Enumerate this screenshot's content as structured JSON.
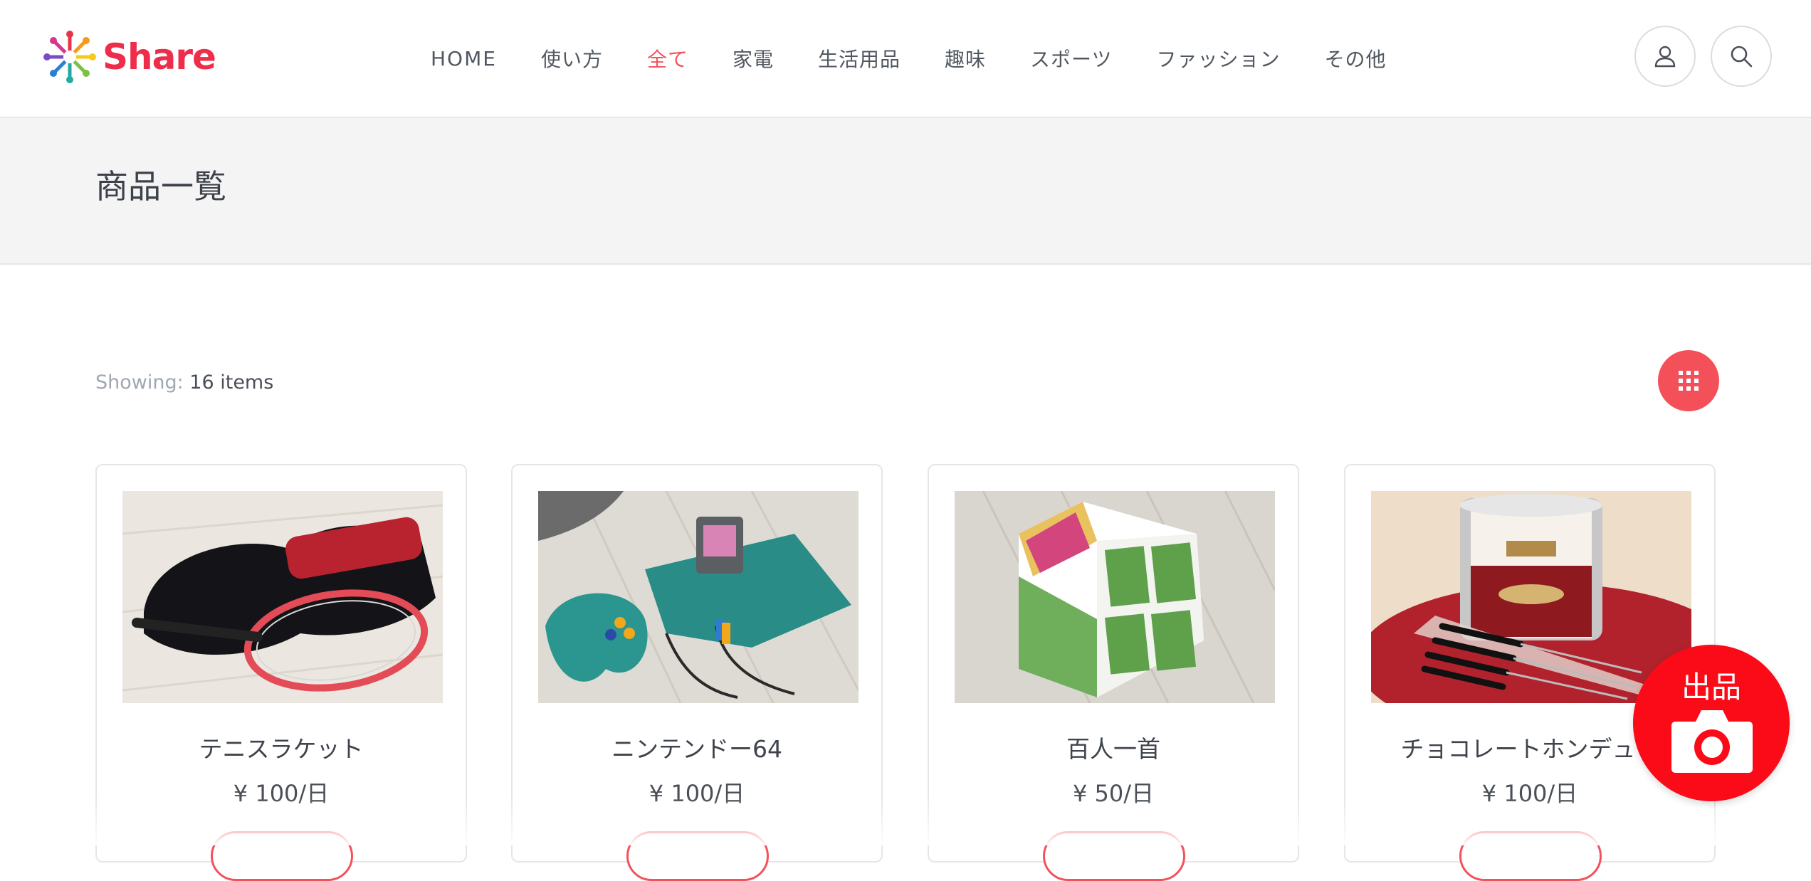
{
  "brand": {
    "name": "Share",
    "color": "#ee2d4b"
  },
  "nav": {
    "items": [
      {
        "label": "HOME"
      },
      {
        "label": "使い方"
      },
      {
        "label": "全て",
        "active": true
      },
      {
        "label": "家電"
      },
      {
        "label": "生活用品"
      },
      {
        "label": "趣味"
      },
      {
        "label": "スポーツ"
      },
      {
        "label": "ファッション"
      },
      {
        "label": "その他"
      }
    ],
    "active_color": "#f2525b"
  },
  "header_icons": [
    "user-icon",
    "search-icon"
  ],
  "page": {
    "title": "商品一覧"
  },
  "listing": {
    "showing_label": "Showing:",
    "showing_count": "16 items",
    "view_toggle_icon": "grid-icon"
  },
  "products": [
    {
      "name": "テニスラケット",
      "price": "¥ 100/日"
    },
    {
      "name": "ニンテンドー64",
      "price": "¥ 100/日"
    },
    {
      "name": "百人一首",
      "price": "¥ 50/日"
    },
    {
      "name": "チョコレートホンデュセ",
      "price": "¥ 100/日"
    }
  ],
  "sell_button": {
    "label": "出品",
    "icon": "camera-icon",
    "color": "#fb0b18"
  }
}
